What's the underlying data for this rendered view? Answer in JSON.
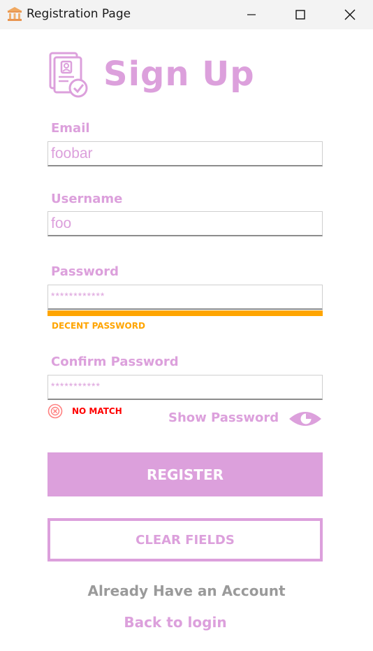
{
  "window": {
    "title": "Registration Page",
    "icons": {
      "app": "bank-icon",
      "minimize": "minimize-icon",
      "maximize": "maximize-icon",
      "close": "close-icon"
    }
  },
  "header": {
    "title": "Sign Up",
    "icon": "document-check-icon"
  },
  "form": {
    "email": {
      "label": "Email",
      "value": "foobar"
    },
    "username": {
      "label": "Username",
      "value": "foo"
    },
    "password": {
      "label": "Password",
      "value": "************",
      "strength_text": "DECENT PASSWORD",
      "strength_color": "#ffa500",
      "strength_fraction": 1.0
    },
    "confirm": {
      "label": "Confirm Password",
      "value": "***********",
      "match_text": "NO MATCH",
      "match_color": "#ff0000",
      "match_icon": "x-circle-icon"
    },
    "show_password": {
      "label": "Show Password",
      "icon": "eye-icon"
    }
  },
  "buttons": {
    "register": "REGISTER",
    "clear": "CLEAR FIELDS"
  },
  "footer": {
    "prompt": "Already Have an Account",
    "link": "Back to login"
  },
  "colors": {
    "accent": "#dca0dc",
    "muted": "#9a9a9a",
    "warning": "#ffa500",
    "error": "#ff0000"
  }
}
